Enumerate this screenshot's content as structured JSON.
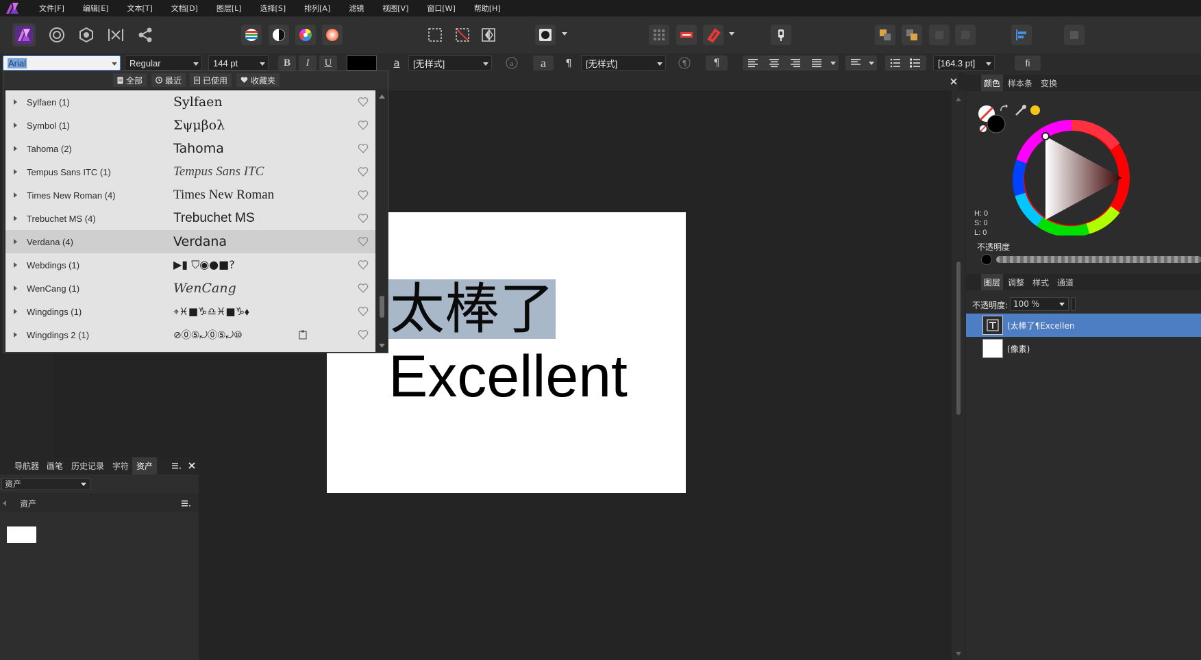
{
  "menu": {
    "items": [
      "文件[F]",
      "编辑[E]",
      "文本[T]",
      "文档[D]",
      "图层[L]",
      "选择[S]",
      "排列[A]",
      "滤镜",
      "视图[V]",
      "窗口[W]",
      "帮助[H]"
    ]
  },
  "context_bar": {
    "font_name": "Arial",
    "font_style": "Regular",
    "font_size": "144 pt",
    "char_style": "[无样式]",
    "para_style": "[无样式]",
    "leading": "[164.3 pt]",
    "bold_label": "B",
    "italic_label": "I",
    "underline_label": "U",
    "char_a_label": "a",
    "char_a2_label": "a",
    "pilcrow_label": "¶",
    "pilcrow2_label": "¶",
    "ligature_label": "fi",
    "text_color": "#000000"
  },
  "font_dropdown": {
    "filters": [
      "全部",
      "最近",
      "已使用",
      "收藏夹"
    ],
    "fonts": [
      {
        "name": "Sylfaen (1)",
        "preview": "Sylfaen",
        "selected": false
      },
      {
        "name": "Symbol (1)",
        "preview": "Σψμβολ",
        "selected": false
      },
      {
        "name": "Tahoma (2)",
        "preview": "Tahoma",
        "selected": false
      },
      {
        "name": "Tempus Sans ITC (1)",
        "preview": "Tempus Sans ITC",
        "selected": false
      },
      {
        "name": "Times New Roman (4)",
        "preview": "Times New Roman",
        "selected": false
      },
      {
        "name": "Trebuchet MS (4)",
        "preview": "Trebuchet MS",
        "selected": false
      },
      {
        "name": "Verdana (4)",
        "preview": "Verdana",
        "selected": true
      },
      {
        "name": "Webdings (1)",
        "preview": "▶▮ ⛉◉●■?",
        "selected": false
      },
      {
        "name": "WenCang (1)",
        "preview": "WenCang",
        "selected": false
      },
      {
        "name": "Wingdings (1)",
        "preview": "⌖♓■♑♎♓■♑⬧",
        "selected": false
      },
      {
        "name": "Wingdings 2 (1)",
        "preview": "⊘⓪⑤⤾⓪⑤⤾⑩",
        "selected": false
      }
    ]
  },
  "document": {
    "text_line1": "太棒了",
    "text_line2": "Excellent"
  },
  "bottom_left_panel": {
    "tabs": [
      "导航器",
      "画笔",
      "历史记录",
      "字符",
      "资产"
    ],
    "active_tab": "资产",
    "select_value": "资产",
    "category": "资产"
  },
  "right_panel": {
    "color_tabs": [
      "颜色",
      "样本条",
      "变换"
    ],
    "hsl": {
      "h": "H: 0",
      "s": "S: 0",
      "l": "L: 0"
    },
    "opacity_label": "不透明度",
    "layer_tabs": [
      "图层",
      "调整",
      "样式",
      "通道"
    ],
    "layers_opacity_label": "不透明度:",
    "layers_opacity_value": "100 %",
    "layers": [
      {
        "name": "(太棒了¶Excellen",
        "type": "text",
        "selected": true
      },
      {
        "name": "(像素)",
        "type": "pixel",
        "selected": false
      }
    ]
  },
  "colors": {
    "accent": "#4d7dc2",
    "selection_highlight": "#a9b8c9"
  }
}
